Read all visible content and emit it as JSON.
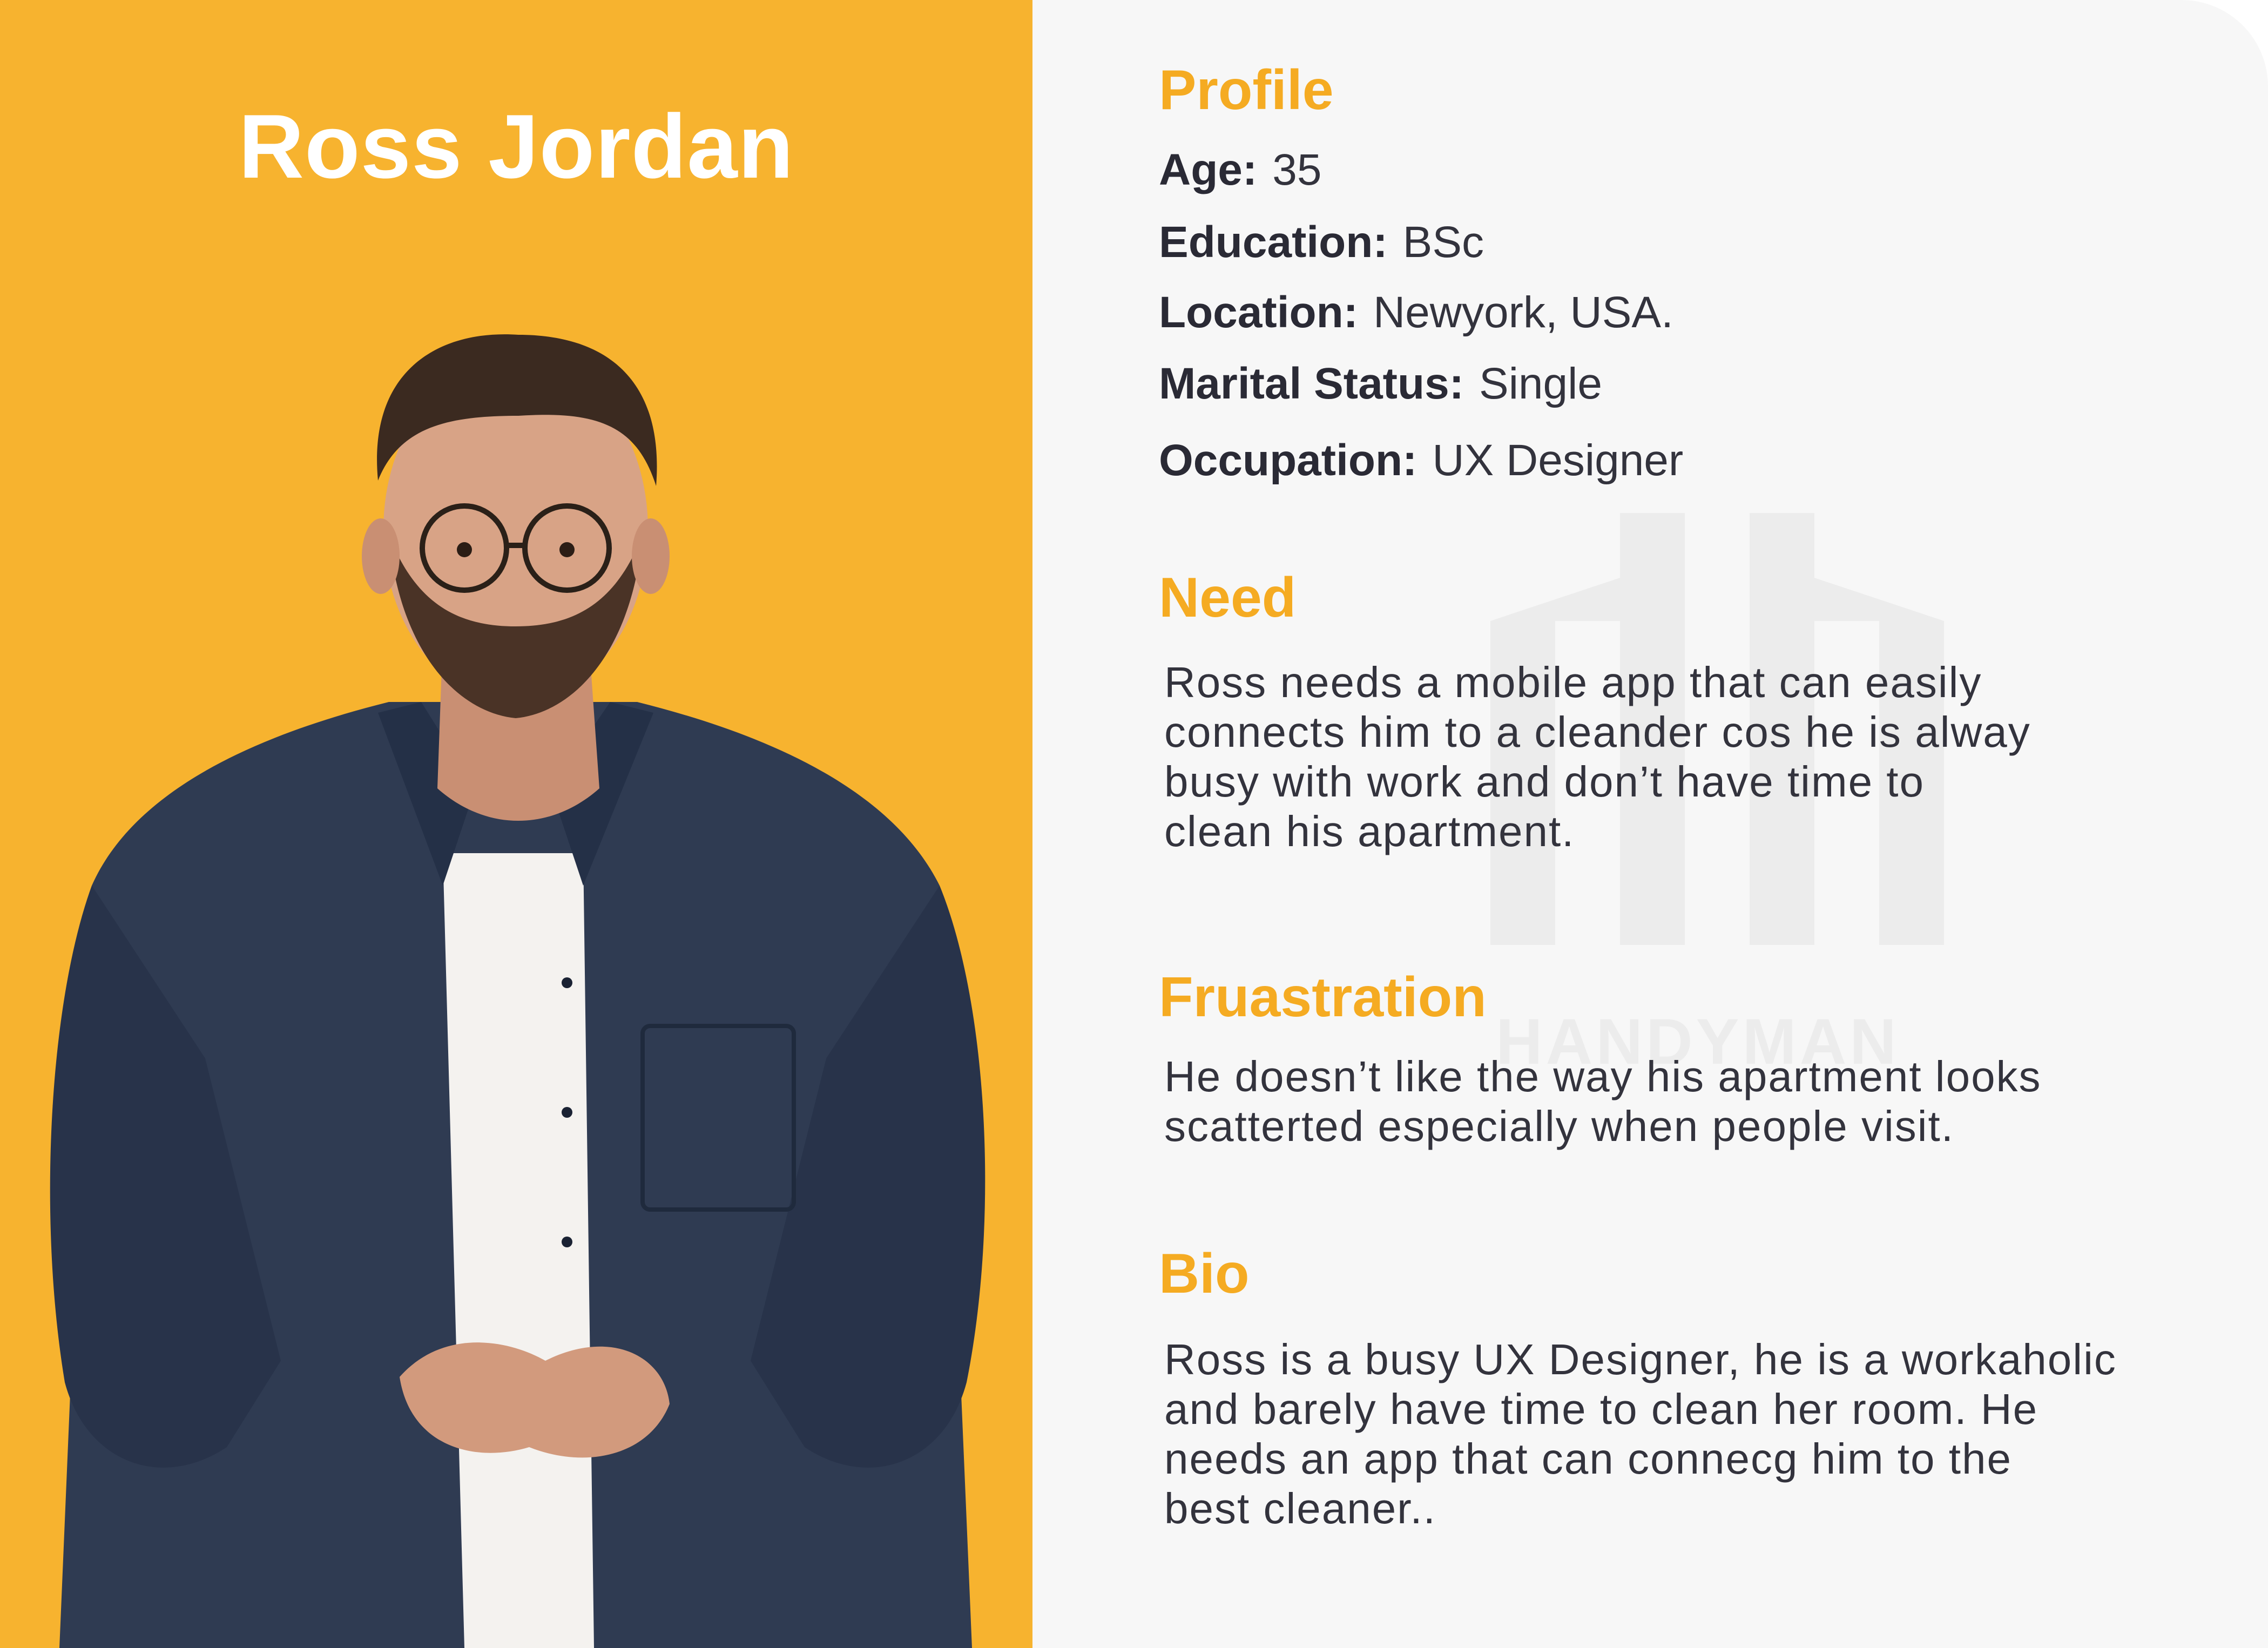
{
  "name": "Ross Jordan",
  "profile": {
    "heading": "Profile",
    "rows": [
      {
        "label": "Age:",
        "value": "35"
      },
      {
        "label": "Education:",
        "value": "BSc"
      },
      {
        "label": "Location:",
        "value": "Newyork, USA."
      },
      {
        "label": "Marital Status:",
        "value": "Single"
      },
      {
        "label": "Occupation:",
        "value": "UX Designer"
      }
    ]
  },
  "need": {
    "heading": "Need",
    "lines": [
      "Ross needs a mobile app that can easily",
      "connects him to a cleander cos he is alway",
      "busy with work and don’t have time to",
      "clean  his apartment."
    ]
  },
  "frustration": {
    "heading": "Fruastration",
    "lines": [
      "He doesn’t like the way his apartment looks",
      "scatterted especially when people visit."
    ]
  },
  "bio": {
    "heading": "Bio",
    "lines": [
      "Ross is a busy UX Designer, he is a workaholic",
      "and barely have time to clean her room. He",
      "needs an app that can connecg him to the",
      "best cleaner.."
    ]
  },
  "watermark": "HANDYMAN",
  "colors": {
    "accent": "#f5ab22",
    "panel": "#f7b32f",
    "background": "#f7f7f7",
    "text": "#2a2a35"
  }
}
